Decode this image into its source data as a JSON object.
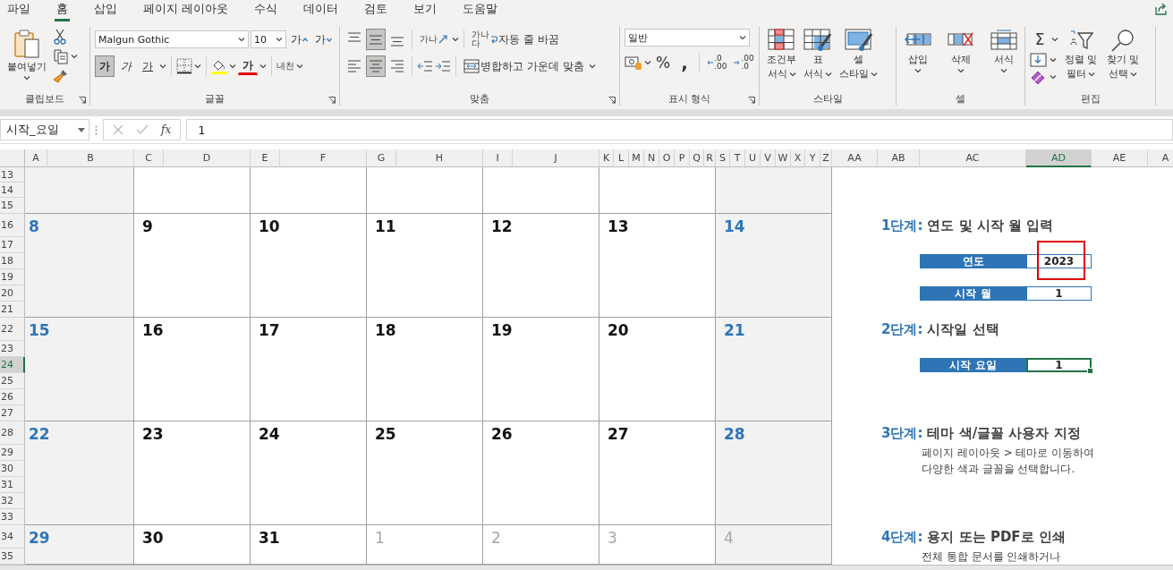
{
  "ribbon_tabs": [
    {
      "label": "파일",
      "selected": false
    },
    {
      "label": "홈",
      "selected": true
    },
    {
      "label": "삽입",
      "selected": false
    },
    {
      "label": "페이지 레이아웃",
      "selected": false
    },
    {
      "label": "수식",
      "selected": false
    },
    {
      "label": "데이터",
      "selected": false
    },
    {
      "label": "검토",
      "selected": false
    },
    {
      "label": "보기",
      "selected": false
    },
    {
      "label": "도움말",
      "selected": false
    }
  ],
  "clipboard": {
    "label": "클립보드",
    "paste": "붙여넣기"
  },
  "font": {
    "label": "글꼴",
    "name": "Malgun Gothic",
    "size": "10",
    "grow": "가",
    "shrink": "가",
    "styles": [
      {
        "kind": "bold",
        "glyph": "가",
        "pressed": true
      },
      {
        "kind": "italic",
        "glyph": "가",
        "pressed": false
      },
      {
        "kind": "underline",
        "glyph": "가",
        "pressed": false
      }
    ],
    "font_color": "가",
    "phonetic": "내천"
  },
  "alignment": {
    "label": "맞춤",
    "vertical": [
      {
        "kind": "top",
        "pressed": false
      },
      {
        "kind": "middle",
        "pressed": true
      },
      {
        "kind": "bottom",
        "pressed": false
      }
    ],
    "horizontal": [
      {
        "kind": "left",
        "pressed": false
      },
      {
        "kind": "center",
        "pressed": true
      },
      {
        "kind": "right",
        "pressed": false
      }
    ],
    "orientation": "가나",
    "wrap_glyph": "가나다",
    "wrap": "자동 줄 바꿈",
    "merge": "병합하고 가운데 맞춤"
  },
  "number": {
    "label": "표시 형식",
    "format": "일반",
    "percent": "%",
    "comma": ",",
    "decrease_decimal": [
      ".0",
      ".00"
    ],
    "increase_decimal": [
      ".00",
      ".0"
    ]
  },
  "styles": {
    "label": "스타일",
    "buttons": [
      {
        "kind": "conditional",
        "lines": [
          "조건부",
          "서식"
        ]
      },
      {
        "kind": "table",
        "lines": [
          "표",
          "서식"
        ]
      },
      {
        "kind": "cell",
        "lines": [
          "셀",
          "스타일"
        ]
      }
    ]
  },
  "cells": {
    "label": "셀",
    "buttons": [
      {
        "kind": "insert",
        "text": "삽입"
      },
      {
        "kind": "delete",
        "text": "삭제"
      },
      {
        "kind": "format",
        "text": "서식"
      }
    ]
  },
  "editing": {
    "label": "편집",
    "sum": "Σ",
    "buttons": [
      {
        "kind": "sort",
        "lines": [
          "정렬 및",
          "필터"
        ]
      },
      {
        "kind": "find",
        "lines": [
          "찾기 및",
          "선택"
        ]
      }
    ]
  },
  "formula_bar": {
    "name_box": "시작_요일",
    "fx": "fx",
    "value": "1"
  },
  "columns": [
    {
      "label": "A",
      "selected": false
    },
    {
      "label": "B",
      "selected": false
    },
    {
      "label": "C",
      "selected": false
    },
    {
      "label": "D",
      "selected": false
    },
    {
      "label": "E",
      "selected": false
    },
    {
      "label": "F",
      "selected": false
    },
    {
      "label": "G",
      "selected": false
    },
    {
      "label": "H",
      "selected": false
    },
    {
      "label": "I",
      "selected": false
    },
    {
      "label": "J",
      "selected": false
    },
    {
      "label": "K",
      "selected": false
    },
    {
      "label": "L",
      "selected": false
    },
    {
      "label": "M",
      "selected": false
    },
    {
      "label": "N",
      "selected": false
    },
    {
      "label": "O",
      "selected": false
    },
    {
      "label": "P",
      "selected": false
    },
    {
      "label": "Q",
      "selected": false
    },
    {
      "label": "R",
      "selected": false
    },
    {
      "label": "S",
      "selected": false
    },
    {
      "label": "T",
      "selected": false
    },
    {
      "label": "U",
      "selected": false
    },
    {
      "label": "V",
      "selected": false
    },
    {
      "label": "W",
      "selected": false
    },
    {
      "label": "X",
      "selected": false
    },
    {
      "label": "Y",
      "selected": false
    },
    {
      "label": "Z",
      "selected": false
    },
    {
      "label": "AA",
      "selected": false
    },
    {
      "label": "AB",
      "selected": false
    },
    {
      "label": "AC",
      "selected": false
    },
    {
      "label": "AD",
      "selected": true
    },
    {
      "label": "AE",
      "selected": false
    },
    {
      "label": "A",
      "selected": false
    }
  ],
  "rows": [
    {
      "label": "13",
      "selected": false
    },
    {
      "label": "14",
      "selected": false
    },
    {
      "label": "15",
      "selected": false
    },
    {
      "label": "16",
      "selected": false
    },
    {
      "label": "17",
      "selected": false
    },
    {
      "label": "18",
      "selected": false
    },
    {
      "label": "19",
      "selected": false
    },
    {
      "label": "20",
      "selected": false
    },
    {
      "label": "21",
      "selected": false
    },
    {
      "label": "22",
      "selected": false
    },
    {
      "label": "23",
      "selected": false
    },
    {
      "label": "24",
      "selected": true
    },
    {
      "label": "25",
      "selected": false
    },
    {
      "label": "26",
      "selected": false
    },
    {
      "label": "27",
      "selected": false
    },
    {
      "label": "28",
      "selected": false
    },
    {
      "label": "29",
      "selected": false
    },
    {
      "label": "30",
      "selected": false
    },
    {
      "label": "31",
      "selected": false
    },
    {
      "label": "32",
      "selected": false
    },
    {
      "label": "33",
      "selected": false
    },
    {
      "label": "34",
      "selected": false
    },
    {
      "label": "35",
      "selected": false
    }
  ],
  "calendar": {
    "top_week": [
      {
        "kind": "weekend"
      },
      {
        "kind": "weekday"
      },
      {
        "kind": "weekday"
      },
      {
        "kind": "weekday"
      },
      {
        "kind": "weekday"
      },
      {
        "kind": "weekday"
      },
      {
        "kind": "weekend"
      }
    ],
    "weeks": [
      [
        {
          "day": "8",
          "kind": "weekend"
        },
        {
          "day": "9",
          "kind": "weekday"
        },
        {
          "day": "10",
          "kind": "weekday"
        },
        {
          "day": "11",
          "kind": "weekday"
        },
        {
          "day": "12",
          "kind": "weekday"
        },
        {
          "day": "13",
          "kind": "weekday"
        },
        {
          "day": "14",
          "kind": "weekend"
        }
      ],
      [
        {
          "day": "15",
          "kind": "weekend"
        },
        {
          "day": "16",
          "kind": "weekday"
        },
        {
          "day": "17",
          "kind": "weekday"
        },
        {
          "day": "18",
          "kind": "weekday"
        },
        {
          "day": "19",
          "kind": "weekday"
        },
        {
          "day": "20",
          "kind": "weekday"
        },
        {
          "day": "21",
          "kind": "weekend"
        }
      ],
      [
        {
          "day": "22",
          "kind": "weekend"
        },
        {
          "day": "23",
          "kind": "weekday"
        },
        {
          "day": "24",
          "kind": "weekday"
        },
        {
          "day": "25",
          "kind": "weekday"
        },
        {
          "day": "26",
          "kind": "weekday"
        },
        {
          "day": "27",
          "kind": "weekday"
        },
        {
          "day": "28",
          "kind": "weekend"
        }
      ],
      [
        {
          "day": "29",
          "kind": "weekend"
        },
        {
          "day": "30",
          "kind": "weekday"
        },
        {
          "day": "31",
          "kind": "weekday"
        },
        {
          "day": "1",
          "kind": "other"
        },
        {
          "day": "2",
          "kind": "other"
        },
        {
          "day": "3",
          "kind": "other"
        },
        {
          "day": "4",
          "kind": "other_weekend"
        }
      ]
    ]
  },
  "steps": [
    {
      "step": "1단계:",
      "title": "연도 및 시작 월 입력",
      "fields": [
        {
          "label": "연도",
          "value": "2023",
          "selected": false,
          "highlighted": true
        },
        {
          "label": "시작 월",
          "value": "1",
          "selected": false,
          "highlighted": false
        }
      ]
    },
    {
      "step": "2단계:",
      "title": "시작일 선택",
      "fields": [
        {
          "label": "시작 요일",
          "value": "1",
          "selected": true,
          "highlighted": false
        }
      ]
    },
    {
      "step": "3단계:",
      "title": "테마 색/글꼴 사용자 지정",
      "lines": [
        "페이지 레이아웃 > 테마로 이동하여",
        "다양한 색과 글꼴을 선택합니다."
      ]
    },
    {
      "step": "4단계:",
      "title": "용지 또는 PDF로 인쇄",
      "lines": [
        "전체 통합 문서를 인쇄하거나"
      ]
    }
  ]
}
